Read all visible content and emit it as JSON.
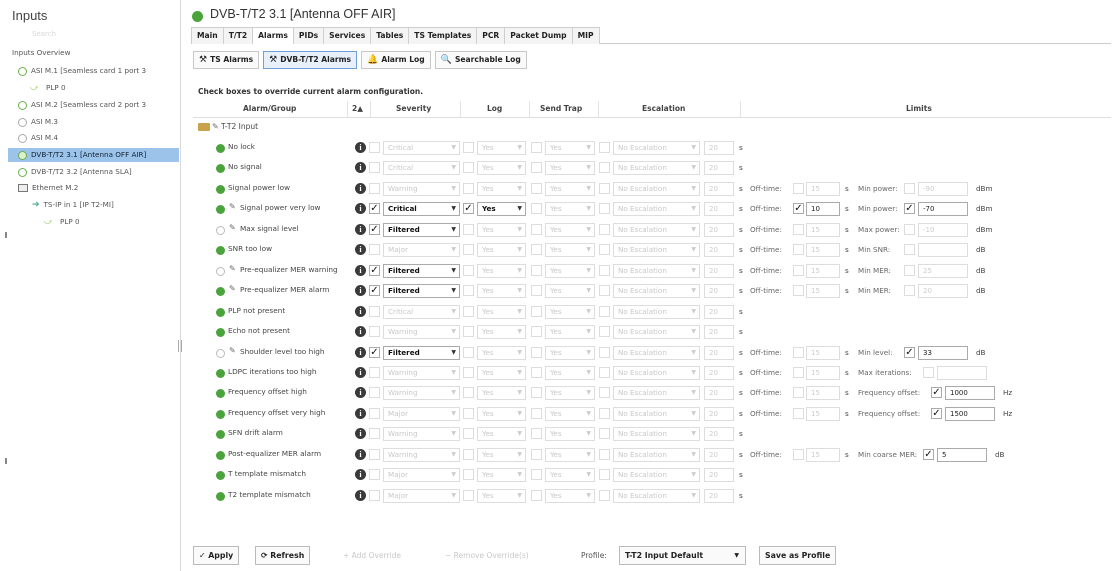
{
  "left_panel": {
    "title": "Inputs",
    "faint_label": "Search",
    "items": [
      {
        "label": "Inputs Overview"
      },
      {
        "label": "ASI M.1 [Seamless card 1 port 3"
      },
      {
        "label": "PLP 0"
      },
      {
        "label": "ASI M.2 [Seamless card 2 port 3"
      },
      {
        "label": "ASI M.3"
      },
      {
        "label": "ASI M.4"
      },
      {
        "label": "DVB-T/T2 3.1 [Antenna OFF AIR]"
      },
      {
        "label": "DVB-T/T2 3.2 [Antenna SLA]"
      },
      {
        "label": "Ethernet M.2"
      },
      {
        "label": "TS-IP in 1 [IP T2-MI]"
      },
      {
        "label": "PLP 0"
      }
    ]
  },
  "header": {
    "title": "DVB-T/T2 3.1 [Antenna OFF AIR]",
    "status_color": "#4ba33c"
  },
  "tabs": [
    "Main",
    "T/T2",
    "Alarms",
    "PIDs",
    "Services",
    "Tables",
    "TS Templates",
    "PCR",
    "Packet Dump",
    "MIP"
  ],
  "active_tab": "Alarms",
  "subtabs": [
    {
      "label": "TS Alarms",
      "icon": "tools-icon"
    },
    {
      "label": "DVB-T/T2 Alarms",
      "icon": "tools-icon"
    },
    {
      "label": "Alarm Log",
      "icon": "bell-icon"
    },
    {
      "label": "Searchable Log",
      "icon": "bell-search-icon"
    }
  ],
  "active_subtab": "DVB-T/T2 Alarms",
  "info_text": "Check boxes to override current alarm configuration.",
  "columns": {
    "alarm_group": "Alarm/Group",
    "sort": "2▲",
    "severity": "Severity",
    "log": "Log",
    "send_trap": "Send Trap",
    "escalation": "Escalation",
    "limits": "Limits"
  },
  "group": {
    "label": "T-T2 Input"
  },
  "common": {
    "yes": "Yes",
    "no_escalation": "No Escalation",
    "esc_value": "20",
    "seconds": "s",
    "off_time": "Off-time:",
    "off_value": "15"
  },
  "rows": [
    {
      "name": "No lock",
      "status": "green",
      "severity": "Critical",
      "sev_on": false
    },
    {
      "name": "No signal",
      "status": "green",
      "severity": "Critical",
      "sev_on": false
    },
    {
      "name": "Signal power low",
      "status": "green",
      "severity": "Warning",
      "sev_on": false,
      "limit_label": "Min power:",
      "limit_value": "-90",
      "limit_unit": "dBm"
    },
    {
      "name": "Signal power very low",
      "status": "green",
      "severity": "Critical",
      "sev_on": true,
      "log_on": true,
      "off_value": "10",
      "off_on": true,
      "limit_label": "Min power:",
      "limit_value": "-70",
      "limit_on": true,
      "limit_unit": "dBm"
    },
    {
      "name": "Max signal level",
      "status": "empty",
      "severity": "Filtered",
      "sev_on": true,
      "limit_label": "Max power:",
      "limit_value": "-10",
      "limit_unit": "dBm"
    },
    {
      "name": "SNR too low",
      "status": "green",
      "severity": "Major",
      "sev_on": false,
      "limit_label": "Min SNR:",
      "limit_value": "",
      "limit_unit": "dB"
    },
    {
      "name": "Pre-equalizer MER warning",
      "status": "empty",
      "severity": "Filtered",
      "sev_on": true,
      "limit_label": "Min MER:",
      "limit_value": "25",
      "limit_unit": "dB"
    },
    {
      "name": "Pre-equalizer MER alarm",
      "status": "green",
      "severity": "Filtered",
      "sev_on": true,
      "limit_label": "Min MER:",
      "limit_value": "20",
      "limit_unit": "dB"
    },
    {
      "name": "PLP not present",
      "status": "green",
      "severity": "Critical",
      "sev_on": false
    },
    {
      "name": "Echo not present",
      "status": "green",
      "severity": "Warning",
      "sev_on": false
    },
    {
      "name": "Shoulder level too high",
      "status": "empty",
      "severity": "Filtered",
      "sev_on": true,
      "limit_label": "Min level:",
      "limit_value": "33",
      "limit_on": true,
      "limit_unit": "dB"
    },
    {
      "name": "LDPC iterations too high",
      "status": "green",
      "severity": "Warning",
      "sev_on": false,
      "limit_label": "Max iterations:",
      "limit_value": "",
      "limit_unit": ""
    },
    {
      "name": "Frequency offset high",
      "status": "green",
      "severity": "Warning",
      "sev_on": false,
      "limit_label": "Frequency offset:",
      "limit_value": "1000",
      "limit_on": true,
      "limit_unit": "Hz"
    },
    {
      "name": "Frequency offset very high",
      "status": "green",
      "severity": "Major",
      "sev_on": false,
      "limit_label": "Frequency offset:",
      "limit_value": "1500",
      "limit_on": true,
      "limit_unit": "Hz"
    },
    {
      "name": "SFN drift alarm",
      "status": "green",
      "severity": "Warning",
      "sev_on": false
    },
    {
      "name": "Post-equalizer MER alarm",
      "status": "green",
      "severity": "Warning",
      "sev_on": false,
      "limit_label": "Min coarse MER:",
      "limit_value": "5",
      "limit_on": true,
      "limit_unit": "dB"
    },
    {
      "name": "T template mismatch",
      "status": "green",
      "severity": "Major",
      "sev_on": false
    },
    {
      "name": "T2 template mismatch",
      "status": "green",
      "severity": "Major",
      "sev_on": false
    }
  ],
  "bottom": {
    "apply": "Apply",
    "refresh": "Refresh",
    "add_override": "Add Override",
    "remove_override": "Remove Override(s)",
    "profile_label": "Profile:",
    "profile_value": "T-T2 Input Default",
    "save_profile": "Save as Profile"
  }
}
